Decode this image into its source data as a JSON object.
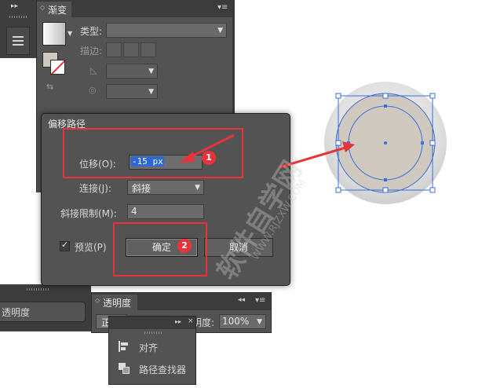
{
  "gradient_panel": {
    "tab_label": "渐变",
    "type_label": "类型:",
    "stroke_label": "描边:"
  },
  "offset_dialog": {
    "title": "偏移路径",
    "offset_label": "位移(O):",
    "offset_value": "-15 px",
    "join_label": "连接(J):",
    "join_value": "斜接",
    "miter_label": "斜接限制(M):",
    "miter_value": "4",
    "preview_label": "预览(P)",
    "preview_checked": true,
    "ok_label": "确定",
    "cancel_label": "取消"
  },
  "annotations": {
    "badge_1": "1",
    "badge_2": "2",
    "accent_color": "#e8333b"
  },
  "left_strip": {
    "label": "透明度"
  },
  "transparency_panel": {
    "tab_label": "透明度",
    "blend_value": "正",
    "opacity_label": "明度:",
    "opacity_value": "100%"
  },
  "floating_menu": {
    "items": [
      {
        "label": "对齐",
        "icon": "align-icon"
      },
      {
        "label": "路径查找器",
        "icon": "pathfinder-icon"
      }
    ]
  },
  "watermark": {
    "line1": "软件自学网",
    "line2": "WWW.RJZXW.COM"
  },
  "colors": {
    "panel": "#535353",
    "selection": "#3a6fd8",
    "shape_fill": "#cfc9bf",
    "outer_circle": "#d7d7d7"
  }
}
